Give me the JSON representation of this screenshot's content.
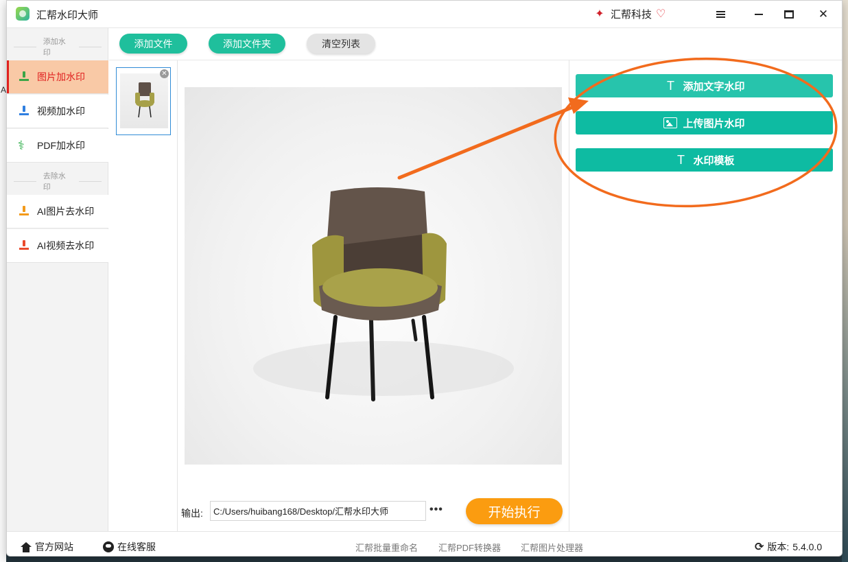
{
  "window": {
    "title": "汇帮水印大师",
    "brand": "汇帮科技"
  },
  "sidebar": {
    "section_add": "添加水印",
    "section_remove": "去除水印",
    "items": [
      {
        "label": "图片加水印",
        "active": true
      },
      {
        "label": "视频加水印"
      },
      {
        "label": "PDF加水印"
      },
      {
        "label": "AI图片去水印"
      },
      {
        "label": "AI视频去水印"
      }
    ]
  },
  "toolbar": {
    "add_file": "添加文件",
    "add_folder": "添加文件夹",
    "clear_list": "清空列表"
  },
  "watermark_panel": {
    "add_text": "添加文字水印",
    "upload_image": "上传图片水印",
    "template": "水印模板"
  },
  "output": {
    "label": "输出:",
    "path": "C:/Users/huibang168/Desktop/汇帮水印大师",
    "more": "•••",
    "start": "开始执行"
  },
  "statusbar": {
    "website": "官方网站",
    "support": "在线客服",
    "links": [
      "汇帮批量重命名",
      "汇帮PDF转换器",
      "汇帮图片处理器"
    ],
    "version_label": "版本:",
    "version": "5.4.0.0"
  },
  "colors": {
    "accent": "#1fbf9c",
    "active_bg": "#f9c9a6",
    "active_text": "#e0201f",
    "start": "#fb9c10",
    "annotation": "#f26b1d"
  }
}
